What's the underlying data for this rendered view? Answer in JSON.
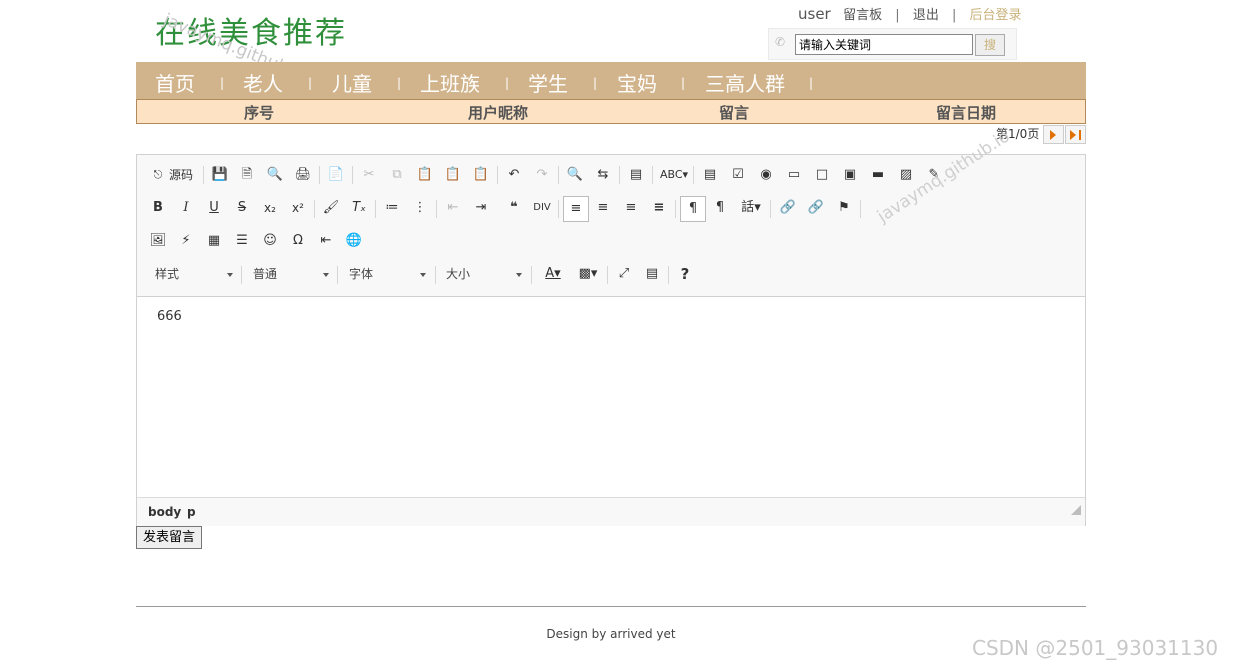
{
  "header": {
    "logo_text": "在线美食推荐",
    "watermark": "javaymq.github.io",
    "user": "user",
    "links": [
      "留言板",
      "退出",
      "后台登录"
    ],
    "separator": "|",
    "search": {
      "value": "请输入关键词",
      "button": "搜"
    }
  },
  "nav": {
    "items": [
      "首页",
      "老人",
      "儿童",
      "上班族",
      "学生",
      "宝妈",
      "三高人群"
    ],
    "separator": "|"
  },
  "table": {
    "columns": [
      "序号",
      "用户昵称",
      "留言",
      "留言日期"
    ]
  },
  "pager": {
    "text": "第1/0页"
  },
  "editor": {
    "source_label": "源码",
    "combos": [
      "样式",
      "普通",
      "字体",
      "大小"
    ],
    "content": "666",
    "path": [
      "body",
      "p"
    ],
    "watermark": "javaymq.github.io"
  },
  "post_button": "发表留言",
  "footer": "Design by arrived yet",
  "csdn_watermark": "CSDN @2501_93031130",
  "colors": {
    "nav_bg": "#d2b48c",
    "thead_bg": "#fde3c3",
    "logo": "#2f8f3a",
    "pager_arrow": "#e07000"
  }
}
